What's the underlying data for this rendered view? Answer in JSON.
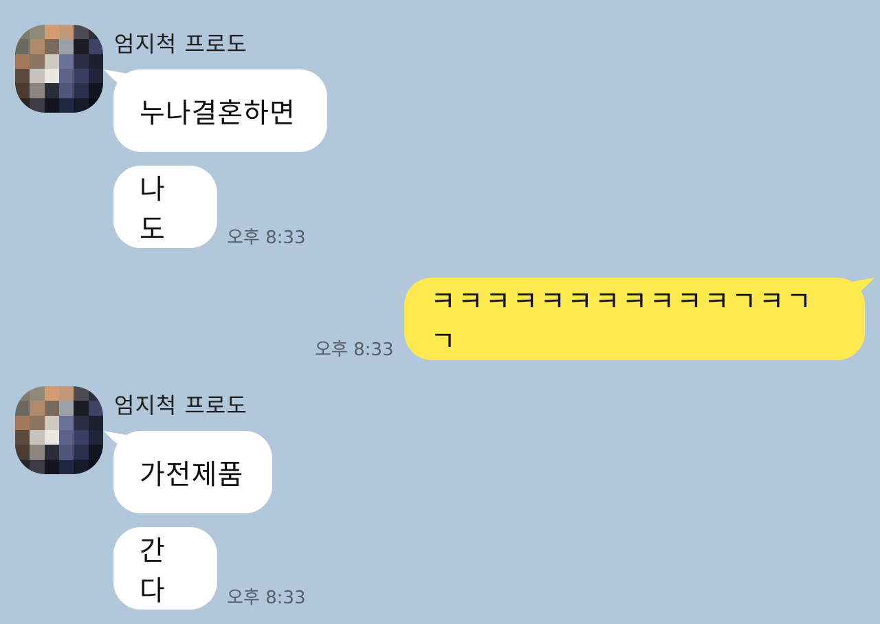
{
  "messages": {
    "group1": {
      "sender": "엄지척 프로도",
      "bubble1": "누나결혼하면",
      "bubble2": "나도",
      "time": "오후 8:33"
    },
    "mine": {
      "bubble": "ㅋㅋㅋㅋㅋㅋㅋㅋㅋㅋㅋㄱㅋㄱㄱ",
      "time": "오후 8:33"
    },
    "group2": {
      "sender": "엄지척 프로도",
      "bubble1": "가전제품",
      "bubble2": "간다",
      "time": "오후 8:33"
    }
  },
  "colors": {
    "background": "#b2c7da",
    "incoming_bubble": "#ffffff",
    "outgoing_bubble": "#fee94e"
  },
  "avatar": {
    "icon": "pixelated-profile-photo"
  }
}
